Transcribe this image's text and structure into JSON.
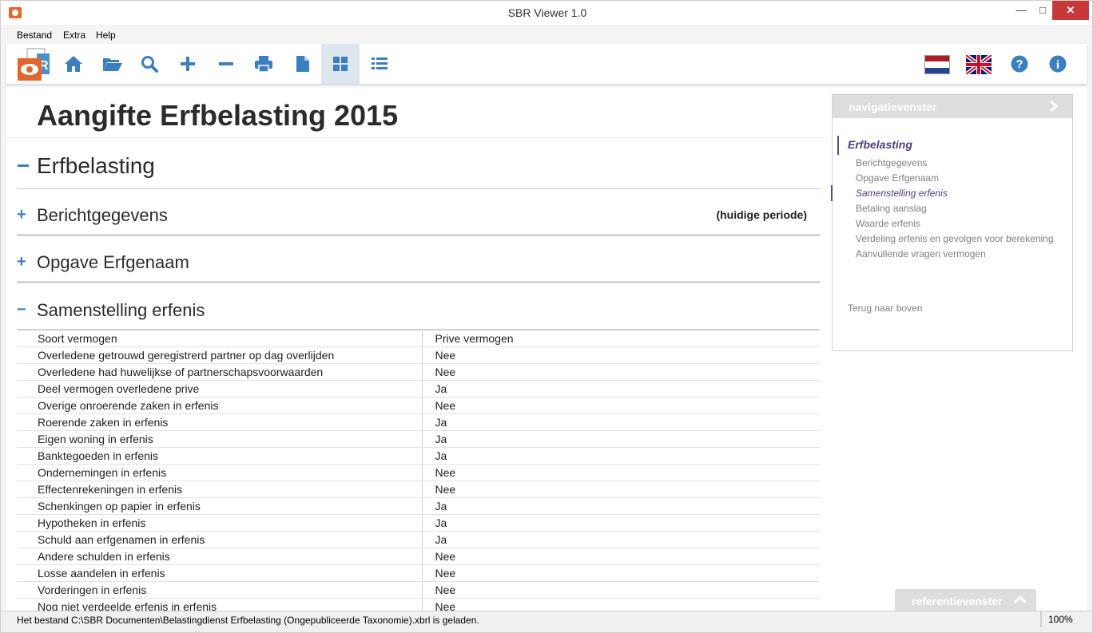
{
  "window": {
    "title": "SBR Viewer 1.0",
    "minimize": "—",
    "maximize": "□",
    "close": "✕"
  },
  "menu": {
    "items": [
      "Bestand",
      "Extra",
      "Help"
    ]
  },
  "toolbar": {
    "icons": [
      "home-icon",
      "folder-open-icon",
      "search-icon",
      "plus-icon",
      "minus-icon",
      "print-icon",
      "document-icon",
      "grid-view-icon",
      "list-view-icon"
    ],
    "active": "grid-view-icon",
    "accent": "#3c7fc1",
    "languages": [
      "nl",
      "en"
    ]
  },
  "document": {
    "title": "Aangifte Erfbelasting 2015",
    "main_section": {
      "toggle": "−",
      "label": "Erfbelasting"
    },
    "sections": [
      {
        "toggle": "+",
        "label": "Berichtgegevens",
        "note": "(huidige periode)"
      },
      {
        "toggle": "+",
        "label": "Opgave Erfgenaam"
      },
      {
        "toggle": "−",
        "label": "Samenstelling erfenis"
      }
    ],
    "table": {
      "header": [
        "Soort vermogen",
        "Prive vermogen"
      ],
      "rows": [
        [
          "Overledene getrouwd geregistrerd partner op dag overlijden",
          "Nee"
        ],
        [
          "Overledene had huwelijkse of partnerschapsvoorwaarden",
          "Nee"
        ],
        [
          "Deel vermogen overledene prive",
          "Ja"
        ],
        [
          "Overige onroerende zaken in erfenis",
          "Nee"
        ],
        [
          "Roerende zaken in erfenis",
          "Ja"
        ],
        [
          "Eigen woning in erfenis",
          "Ja"
        ],
        [
          "Banktegoeden in erfenis",
          "Ja"
        ],
        [
          "Ondernemingen in erfenis",
          "Nee"
        ],
        [
          "Effectenrekeningen in erfenis",
          "Nee"
        ],
        [
          "Schenkingen op papier in erfenis",
          "Ja"
        ],
        [
          "Hypotheken in erfenis",
          "Ja"
        ],
        [
          "Schuld aan erfgenamen in erfenis",
          "Ja"
        ],
        [
          "Andere schulden in erfenis",
          "Nee"
        ],
        [
          "Losse aandelen in erfenis",
          "Nee"
        ],
        [
          "Vorderingen in erfenis",
          "Nee"
        ],
        [
          "Nog niet verdeelde erfenis in erfenis",
          "Nee"
        ]
      ]
    }
  },
  "navigation": {
    "header": "navigatievenster",
    "main": "Erfbelasting",
    "items": [
      "Berichtgegevens",
      "Opgave Erfgenaam",
      "Samenstelling erfenis",
      "Betaling aanslag",
      "Waarde erfenis",
      "Verdeling erfenis en gevolgen voor berekening",
      "Aanvullende vragen vermogen"
    ],
    "active_item": "Samenstelling erfenis",
    "back_to_top": "Terug naar boven"
  },
  "reference": {
    "header": "referentievenster"
  },
  "status": {
    "message": "Het bestand C:\\SBR Documenten\\Belastingdienst Erfbelasting (Ongepubliceerde Taxonomie).xbrl is geladen.",
    "zoom": "100%"
  }
}
